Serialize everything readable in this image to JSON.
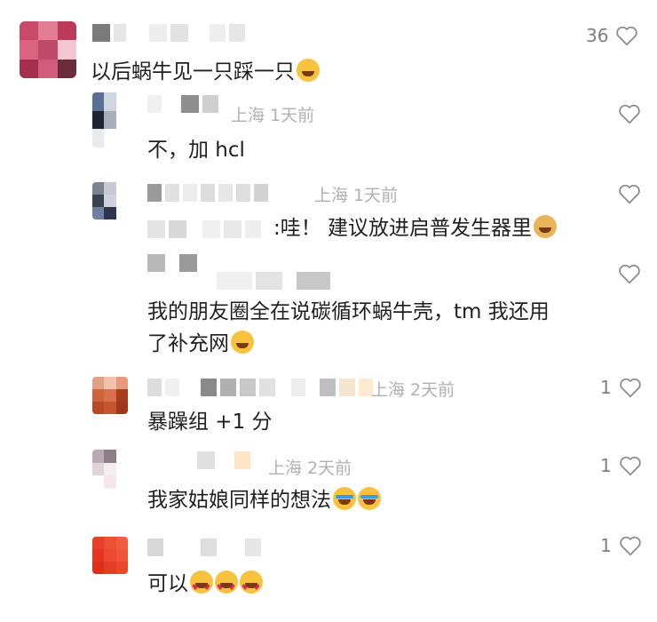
{
  "comments": [
    {
      "text": "以后蜗牛见一只踩一只",
      "meta": "",
      "likes": "36",
      "emojis": [
        "grin"
      ],
      "avatar_colors": [
        "#c84a6a",
        "#e07d93",
        "#b93a5b",
        "#d9647f",
        "#c14a69",
        "#f2c7d2",
        "#a52f4f",
        "#d25c7b",
        "#6b2c3b"
      ]
    },
    {
      "text": "不，加 hcl",
      "meta": "上海 1天前",
      "likes": "",
      "emojis": [],
      "avatar_colors": [
        "#5a6f94",
        "#cfd6e0",
        "#ffffff",
        "#1d2530",
        "#a8afba",
        "#ffffff",
        "#e8eaee",
        "#ffffff",
        "#ffffff"
      ]
    },
    {
      "text": ":哇！ 建议放进启普发生器里",
      "meta": "上海 1天前",
      "likes": "",
      "emojis": [
        "dog"
      ],
      "avatar_colors": [
        "#7c8390",
        "#c7cad0",
        "#ffffff",
        "#3c4150",
        "#cfd2d8",
        "#ffffff",
        "#6f7fa0",
        "#2d3550",
        "#ffffff"
      ]
    },
    {
      "text_lines": [
        "我的朋友圈全在说碳循环蜗牛壳，tm 我还用",
        "了补充网"
      ],
      "meta": "",
      "likes": "",
      "emojis": [
        "smile"
      ],
      "avatar_colors": [
        "#ffffff",
        "#ffffff",
        "#ffffff",
        "#ffffff",
        "#ffffff",
        "#ffffff",
        "#ffffff",
        "#ffffff",
        "#ffffff"
      ]
    },
    {
      "text": "暴躁组 +1 分",
      "meta": "上海 2天前",
      "likes": "1",
      "emojis": [],
      "avatar_colors": [
        "#e0a088",
        "#f0c2ae",
        "#e59a7f",
        "#c9643f",
        "#d9704c",
        "#a83a1d",
        "#ffffff",
        "#ffffff",
        "#ffffff"
      ]
    },
    {
      "text": "我家姑娘同样的想法",
      "meta": "上海 2天前",
      "likes": "1",
      "emojis": [
        "laugh",
        "laugh"
      ],
      "avatar_colors": [
        "#b8a9b2",
        "#8d7d88",
        "#ffffff",
        "#ddd4da",
        "#f2eef0",
        "#ffffff",
        "#ffffff",
        "#f3e6ec",
        "#ffffff"
      ]
    },
    {
      "text": "可以",
      "meta": "",
      "likes": "1",
      "emojis": [
        "hearteyes",
        "hearteyes",
        "hearteyes"
      ],
      "avatar_colors": [
        "#e6402a",
        "#ee5034",
        "#f25d3e",
        "#e4351f",
        "#ed4a30",
        "#f0553a",
        "#ffffff",
        "#ffffff",
        "#ffffff"
      ]
    }
  ]
}
